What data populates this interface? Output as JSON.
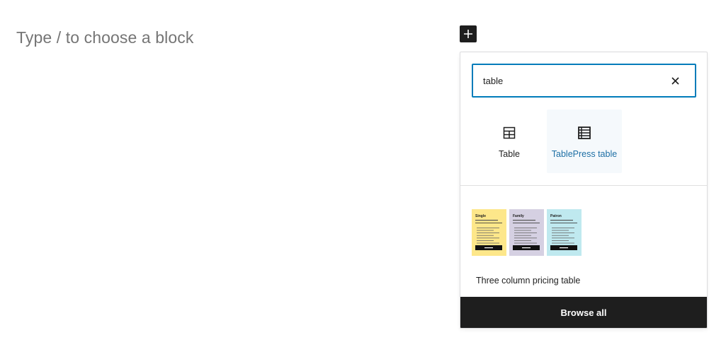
{
  "editor": {
    "placeholder": "Type / to choose a block"
  },
  "inserter": {
    "toggle_icon": "plus-icon",
    "search": {
      "value": "table",
      "clear_icon": "close-icon"
    },
    "blocks": [
      {
        "label": "Table",
        "icon": "table-icon"
      },
      {
        "label": "TablePress table",
        "icon": "tablepress-table-icon"
      }
    ],
    "patterns": [
      {
        "label": "Three column pricing table",
        "columns": [
          {
            "name": "Single",
            "color": "#fde78a"
          },
          {
            "name": "Family",
            "color": "#d5d0e2"
          },
          {
            "name": "Patron",
            "color": "#bfe9ef"
          }
        ]
      }
    ],
    "browse_all_label": "Browse all"
  },
  "colors": {
    "accent": "#007cba",
    "hover_text": "#1d6fa5",
    "dark": "#1e1e1e"
  }
}
